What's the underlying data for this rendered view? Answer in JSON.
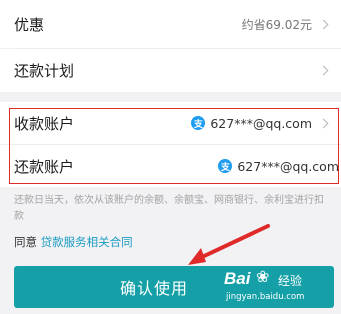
{
  "rows": {
    "discount": {
      "label": "优惠",
      "value": "约省69.02元"
    },
    "plan": {
      "label": "还款计划"
    },
    "receive": {
      "label": "收款账户",
      "account": "627***@qq.com"
    },
    "repay": {
      "label": "还款账户",
      "account": "627***@qq.com"
    }
  },
  "alipay_glyph": "支",
  "note": "还款日当天，依次从该账户的余额、余额宝、网商银行、余利宝进行扣款",
  "agree": {
    "prefix": "同意",
    "link": "贷款服务相关合同"
  },
  "confirm_label": "确认使用",
  "watermark": {
    "brand": "Bai",
    "paw": "❀",
    "jingyan": "经验",
    "url": "jingyan.baidu.com"
  },
  "colors": {
    "button": "#14a0a6",
    "link": "#1c9cc2",
    "highlight": "#e02a2a",
    "alipay": "#1e9cf0"
  }
}
